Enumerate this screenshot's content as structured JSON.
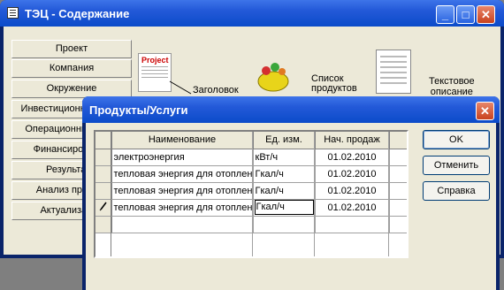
{
  "main_window": {
    "title": "ТЭЦ - Содержание",
    "controls": {
      "minimize": "_",
      "maximize": "□",
      "close": "✕"
    },
    "sidebar": [
      "Проект",
      "Компания",
      "Окружение",
      "Инвестиционный план",
      "Операционный план",
      "Финансирование",
      "Результаты",
      "Анализ проекта",
      "Актуализация"
    ],
    "cards": {
      "project_icon_text": "Project",
      "header_label": "Заголовок",
      "products_label_1": "Список",
      "products_label_2": "продуктов",
      "text_label_1": "Текстовое",
      "text_label_2": "описание"
    }
  },
  "dialog": {
    "title": "Продукты/Услуги",
    "close": "✕",
    "columns": [
      "Наименование",
      "Ед. изм.",
      "Нач. продаж"
    ],
    "rows": [
      {
        "name": "электроэнергия",
        "unit": "кВт/ч",
        "start": "01.02.2010"
      },
      {
        "name": "тепловая энергия для отоплен",
        "unit": "Гкал/ч",
        "start": "01.02.2010"
      },
      {
        "name": "тепловая энергия для отоплен",
        "unit": "Гкал/ч",
        "start": "01.02.2010"
      },
      {
        "name": "тепловая энергия для отоплен",
        "unit": "Гкал/ч",
        "start": "01.02.2010"
      }
    ],
    "buttons": {
      "ok": "OK",
      "cancel": "Отменить",
      "help": "Справка"
    }
  }
}
